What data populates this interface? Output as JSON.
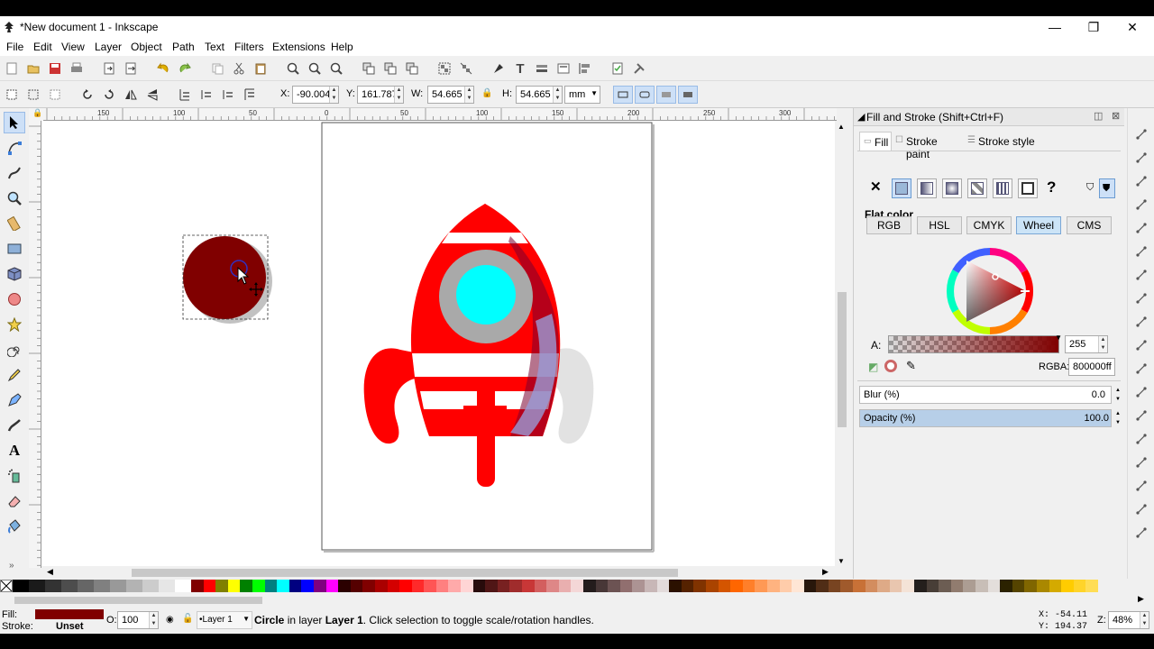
{
  "window": {
    "title": "*New document 1 - Inkscape",
    "minimize": "—",
    "restore": "❐",
    "close": "✕"
  },
  "menu": [
    "File",
    "Edit",
    "View",
    "Layer",
    "Object",
    "Path",
    "Text",
    "Filters",
    "Extensions",
    "Help"
  ],
  "ctrl": {
    "x_label": "X:",
    "x_value": "-90.004",
    "y_label": "Y:",
    "y_value": "161.787",
    "w_label": "W:",
    "w_value": "54.665",
    "h_label": "H:",
    "h_value": "54.665",
    "unit": "mm"
  },
  "ruler_ticks": [
    "150",
    "100",
    "50",
    "0",
    "50",
    "100",
    "150",
    "200",
    "250",
    "300"
  ],
  "panel": {
    "title": "Fill and Stroke (Shift+Ctrl+F)",
    "tabs": [
      "Fill",
      "Stroke paint",
      "Stroke style"
    ],
    "flat_color": "Flat color",
    "modes": [
      "RGB",
      "HSL",
      "CMYK",
      "Wheel",
      "CMS"
    ],
    "alpha_label": "A:",
    "alpha_value": "255",
    "rgba_label": "RGBA:",
    "rgba_value": "800000ff",
    "blur_label": "Blur (%)",
    "blur_value": "0.0",
    "opacity_label": "Opacity (%)",
    "opacity_value": "100.0"
  },
  "status": {
    "fill_label": "Fill:",
    "stroke_label": "Stroke:",
    "stroke_value": "Unset",
    "o_label": "O:",
    "o_value": "100",
    "layer": "•Layer 1",
    "msg_bold": "Circle",
    "msg_mid": " in layer ",
    "msg_layer": "Layer 1",
    "msg_rest": ". Click selection to toggle scale/rotation handles.",
    "cursor_x": "X:  -54.11",
    "cursor_y": "Y:  194.37",
    "zoom_label": "Z:",
    "zoom_value": "48%"
  },
  "colors": {
    "fill": "#800000",
    "accent": "#cce4f7"
  },
  "palette": [
    "#000000",
    "#1a1a1a",
    "#333333",
    "#4d4d4d",
    "#666666",
    "#808080",
    "#999999",
    "#b3b3b3",
    "#cccccc",
    "#e6e6e6",
    "#ffffff",
    "#800000",
    "#ff0000",
    "#808000",
    "#ffff00",
    "#008000",
    "#00ff00",
    "#008080",
    "#00ffff",
    "#000080",
    "#0000ff",
    "#800080",
    "#ff00ff",
    "#2b0000",
    "#550000",
    "#800000",
    "#aa0000",
    "#d40000",
    "#ff0000",
    "#ff2a2a",
    "#ff5555",
    "#ff8080",
    "#ffaaaa",
    "#ffd5d5",
    "#280b0b",
    "#501616",
    "#782121",
    "#a02c2c",
    "#c83737",
    "#d35f5f",
    "#de8787",
    "#e9afaf",
    "#f4d7d7",
    "#241c1c",
    "#483737",
    "#6c5353",
    "#916f6f",
    "#ac9393",
    "#c8b7b7",
    "#e3dbdb",
    "#2b1100",
    "#552200",
    "#803300",
    "#aa4400",
    "#d45500",
    "#ff6600",
    "#ff7f2a",
    "#ff9955",
    "#ffb380",
    "#ffccaa",
    "#ffe6d5",
    "#28170b",
    "#502d16",
    "#784421",
    "#a05a2c",
    "#c87137",
    "#d38d5f",
    "#deaa87",
    "#e9c6af",
    "#f4e3d7",
    "#241f1c",
    "#483e37",
    "#6c5d53",
    "#917c6f",
    "#ac9d93",
    "#c8beb7",
    "#e3dedb",
    "#2b2200",
    "#554400",
    "#806600",
    "#aa8800",
    "#d4aa00",
    "#ffcc00",
    "#ffd42a",
    "#ffdd55"
  ]
}
